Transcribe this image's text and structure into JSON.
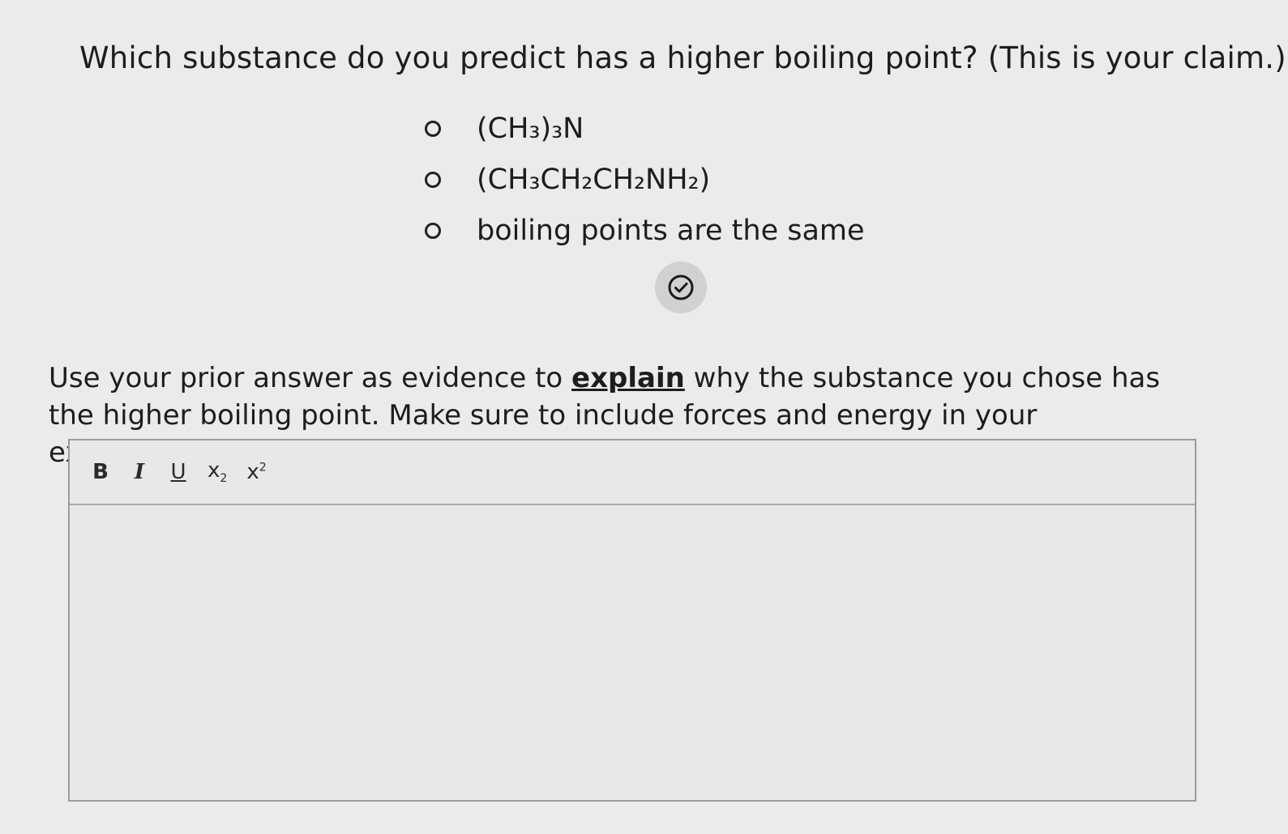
{
  "question": {
    "title": "Which substance do you predict has a higher boiling point? (This is your claim.)",
    "options": [
      {
        "label": "(CH₃)₃N"
      },
      {
        "label": "(CH₃CH₂CH₂NH₂)"
      },
      {
        "label": "boiling points are the same"
      }
    ],
    "submit_icon": "check-circle-icon"
  },
  "explanation": {
    "prompt_before": "Use your prior answer as evidence to ",
    "prompt_emphasis": "explain",
    "prompt_after": " why the substance you chose has the higher boiling point. Make sure to include forces and energy in your explanation."
  },
  "editor": {
    "toolbar": {
      "bold": "B",
      "italic": "I",
      "underline": "U",
      "subscript_base": "x",
      "subscript_mark": "2",
      "superscript_base": "x",
      "superscript_mark": "2"
    },
    "value": ""
  }
}
